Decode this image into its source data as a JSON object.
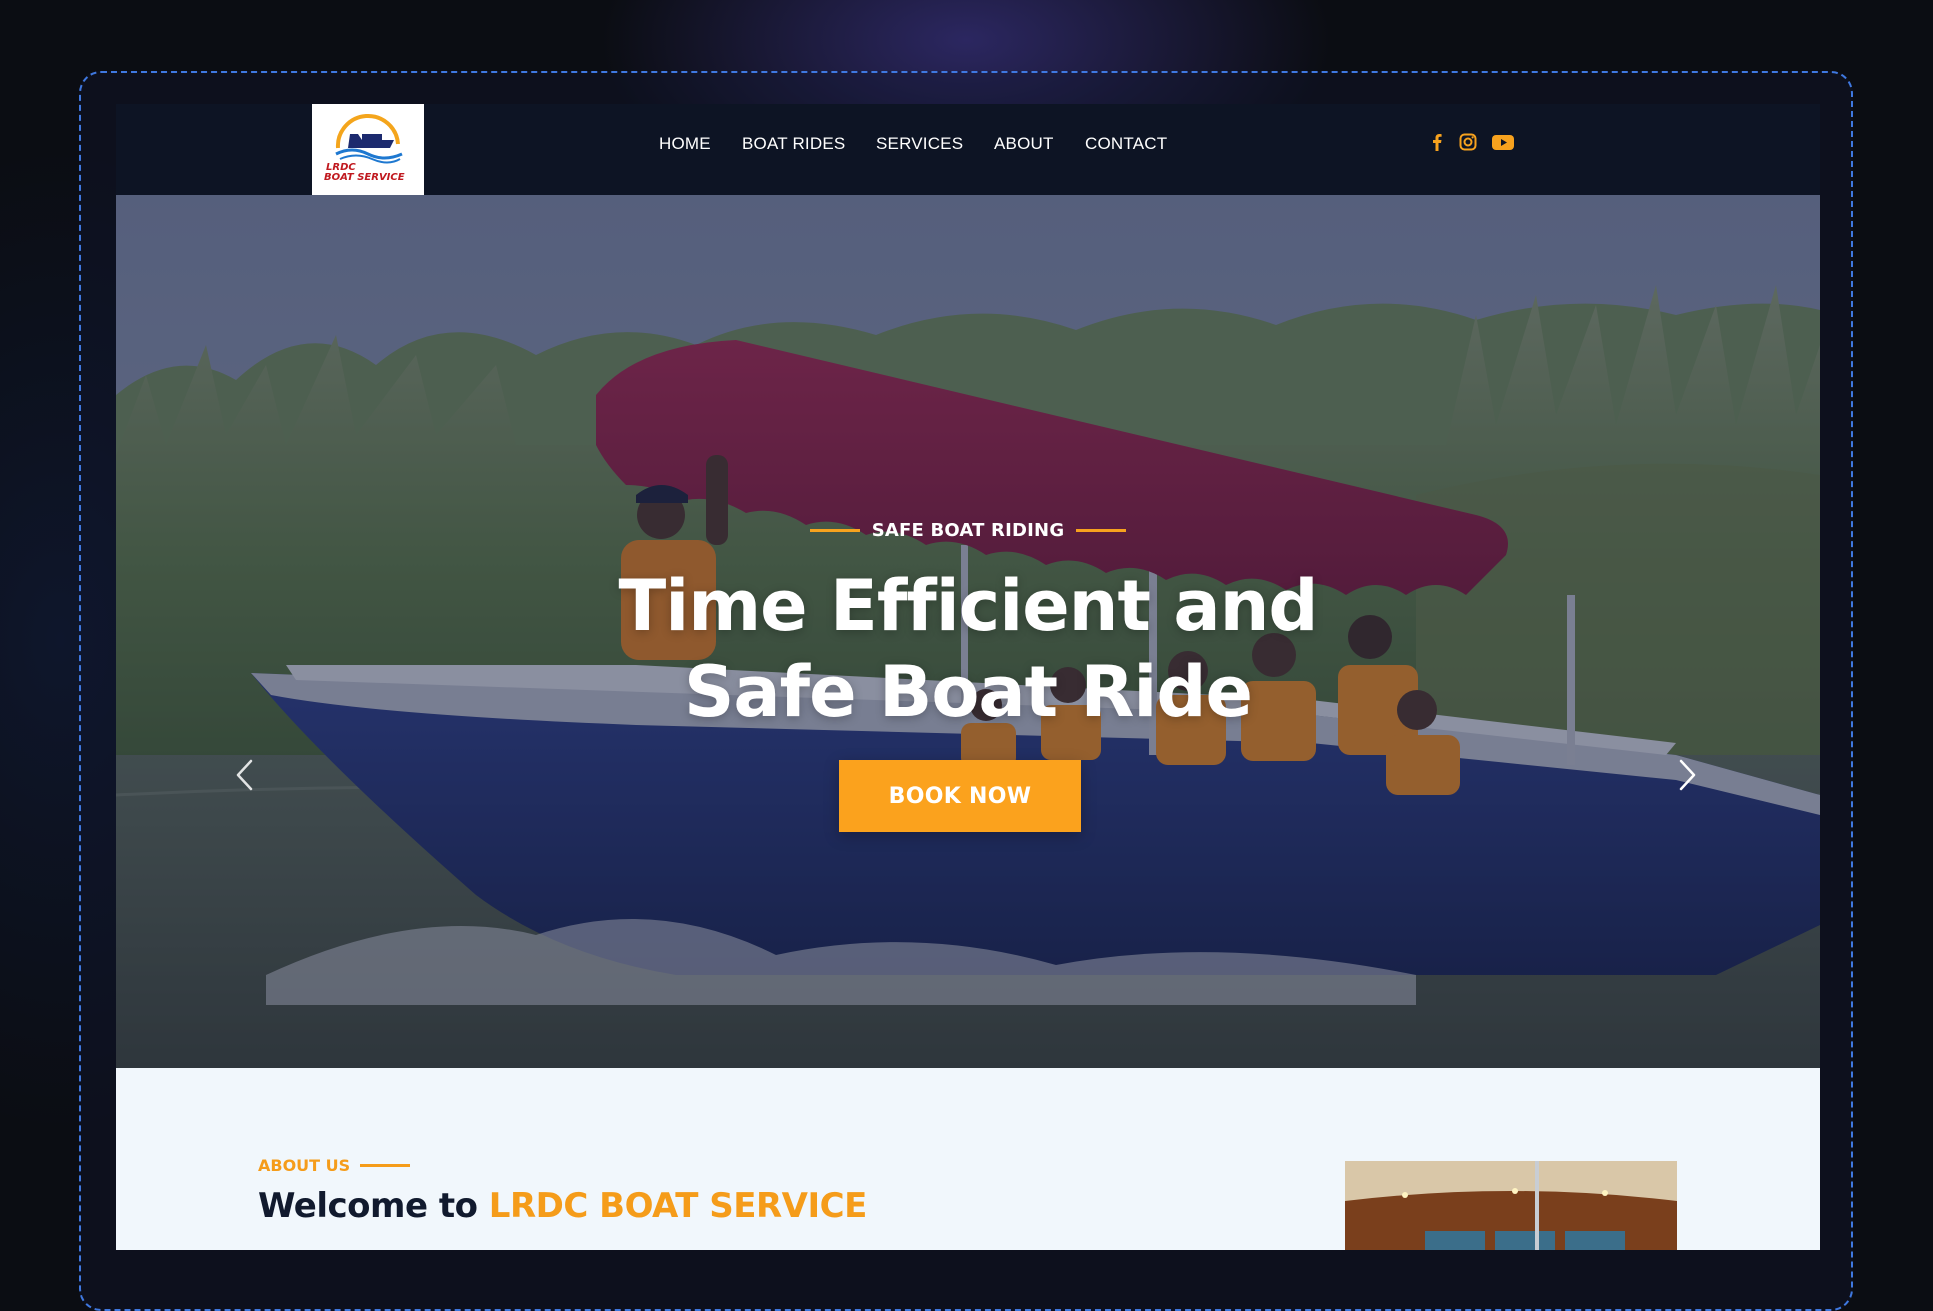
{
  "logo": {
    "line1": "LRDC",
    "line2": "BOAT SERVICE"
  },
  "nav": {
    "items": [
      {
        "label": "HOME"
      },
      {
        "label": "BOAT RIDES"
      },
      {
        "label": "SERVICES"
      },
      {
        "label": "ABOUT"
      },
      {
        "label": "CONTACT"
      }
    ]
  },
  "social": {
    "icons": [
      "facebook-icon",
      "instagram-icon",
      "youtube-icon"
    ],
    "color": "#f7a21e"
  },
  "hero": {
    "eyebrow": "SAFE BOAT RIDING",
    "title_line1": "Time Efficient and",
    "title_line2": "Safe Boat Ride",
    "cta": "BOOK NOW",
    "prev_icon": "chevron-left-icon",
    "next_icon": "chevron-right-icon"
  },
  "about": {
    "tag": "ABOUT US",
    "title_prefix": "Welcome to ",
    "title_brand": "LRDC BOAT SERVICE"
  },
  "colors": {
    "accent": "#f7a21e",
    "header_bg": "#0d1424",
    "dark_text": "#111a2e"
  }
}
